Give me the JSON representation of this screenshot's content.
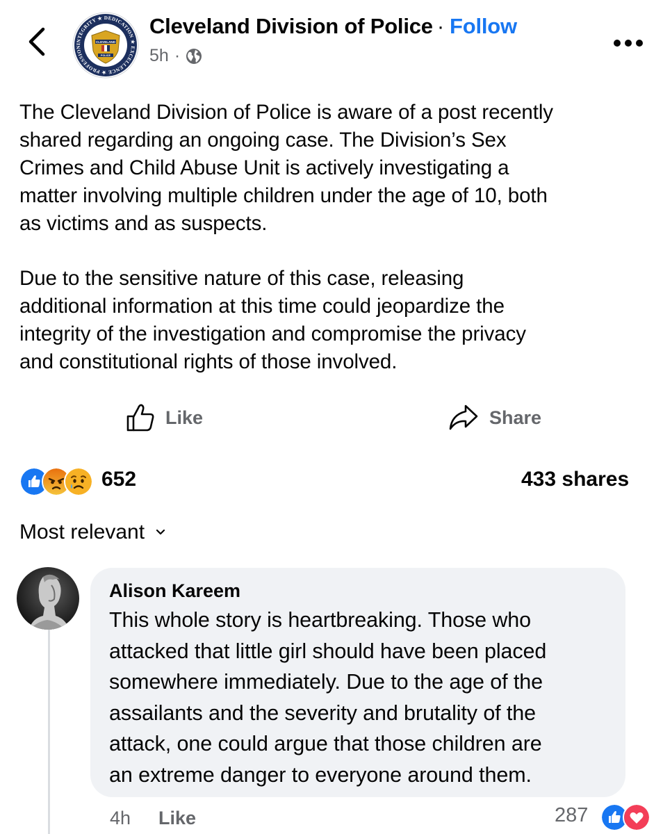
{
  "header": {
    "page_name": "Cleveland Division of Police",
    "separator": "·",
    "follow_label": "Follow",
    "time": "5h",
    "meta_separator": "·",
    "privacy_icon": "globe-icon"
  },
  "badge": {
    "ring_text": "INTEGRITY ★ DEDICATION ★ EXCELLENCE ★ PROFESSIONALISM ★ RESPECT ★",
    "top_text": "CLEVELAND",
    "bottom_text": "POLICE"
  },
  "post": {
    "paragraph1": [
      "The Cleveland Division of Police is aware of a post recently",
      "shared regarding an ongoing case. The Division’s Sex",
      "Crimes and Child Abuse Unit is actively investigating a",
      "matter involving multiple children under the age of 10, both",
      "as victims and as suspects."
    ],
    "paragraph2": [
      "Due to the sensitive nature of this case, releasing",
      "additional information at this time could jeopardize the",
      "integrity of the investigation and compromise the privacy",
      "and constitutional rights of those involved."
    ]
  },
  "actions": {
    "like_label": "Like",
    "share_label": "Share"
  },
  "stats": {
    "reaction_icons": [
      "like-reaction-icon",
      "angry-reaction-icon",
      "sad-reaction-icon"
    ],
    "reaction_count": "652",
    "shares": "433 shares"
  },
  "sort": {
    "label": "Most relevant"
  },
  "comment": {
    "author": "Alison Kareem",
    "lines": [
      "This whole story is heartbreaking. Those who",
      "attacked that little girl should have been placed",
      "somewhere immediately. Due to the age of the",
      "assailants and the severity and brutality of the",
      "attack, one could argue that those children are",
      "an extreme danger to everyone around them."
    ],
    "time": "4h",
    "like_label": "Like",
    "reaction_count": "287",
    "reaction_icons": [
      "like-reaction-icon",
      "love-reaction-icon"
    ]
  },
  "colors": {
    "accent": "#1877f2",
    "secondary_text": "#65676b",
    "bubble": "#f0f2f5",
    "badge_navy": "#1c2f5e",
    "badge_gold": "#d9a521"
  }
}
